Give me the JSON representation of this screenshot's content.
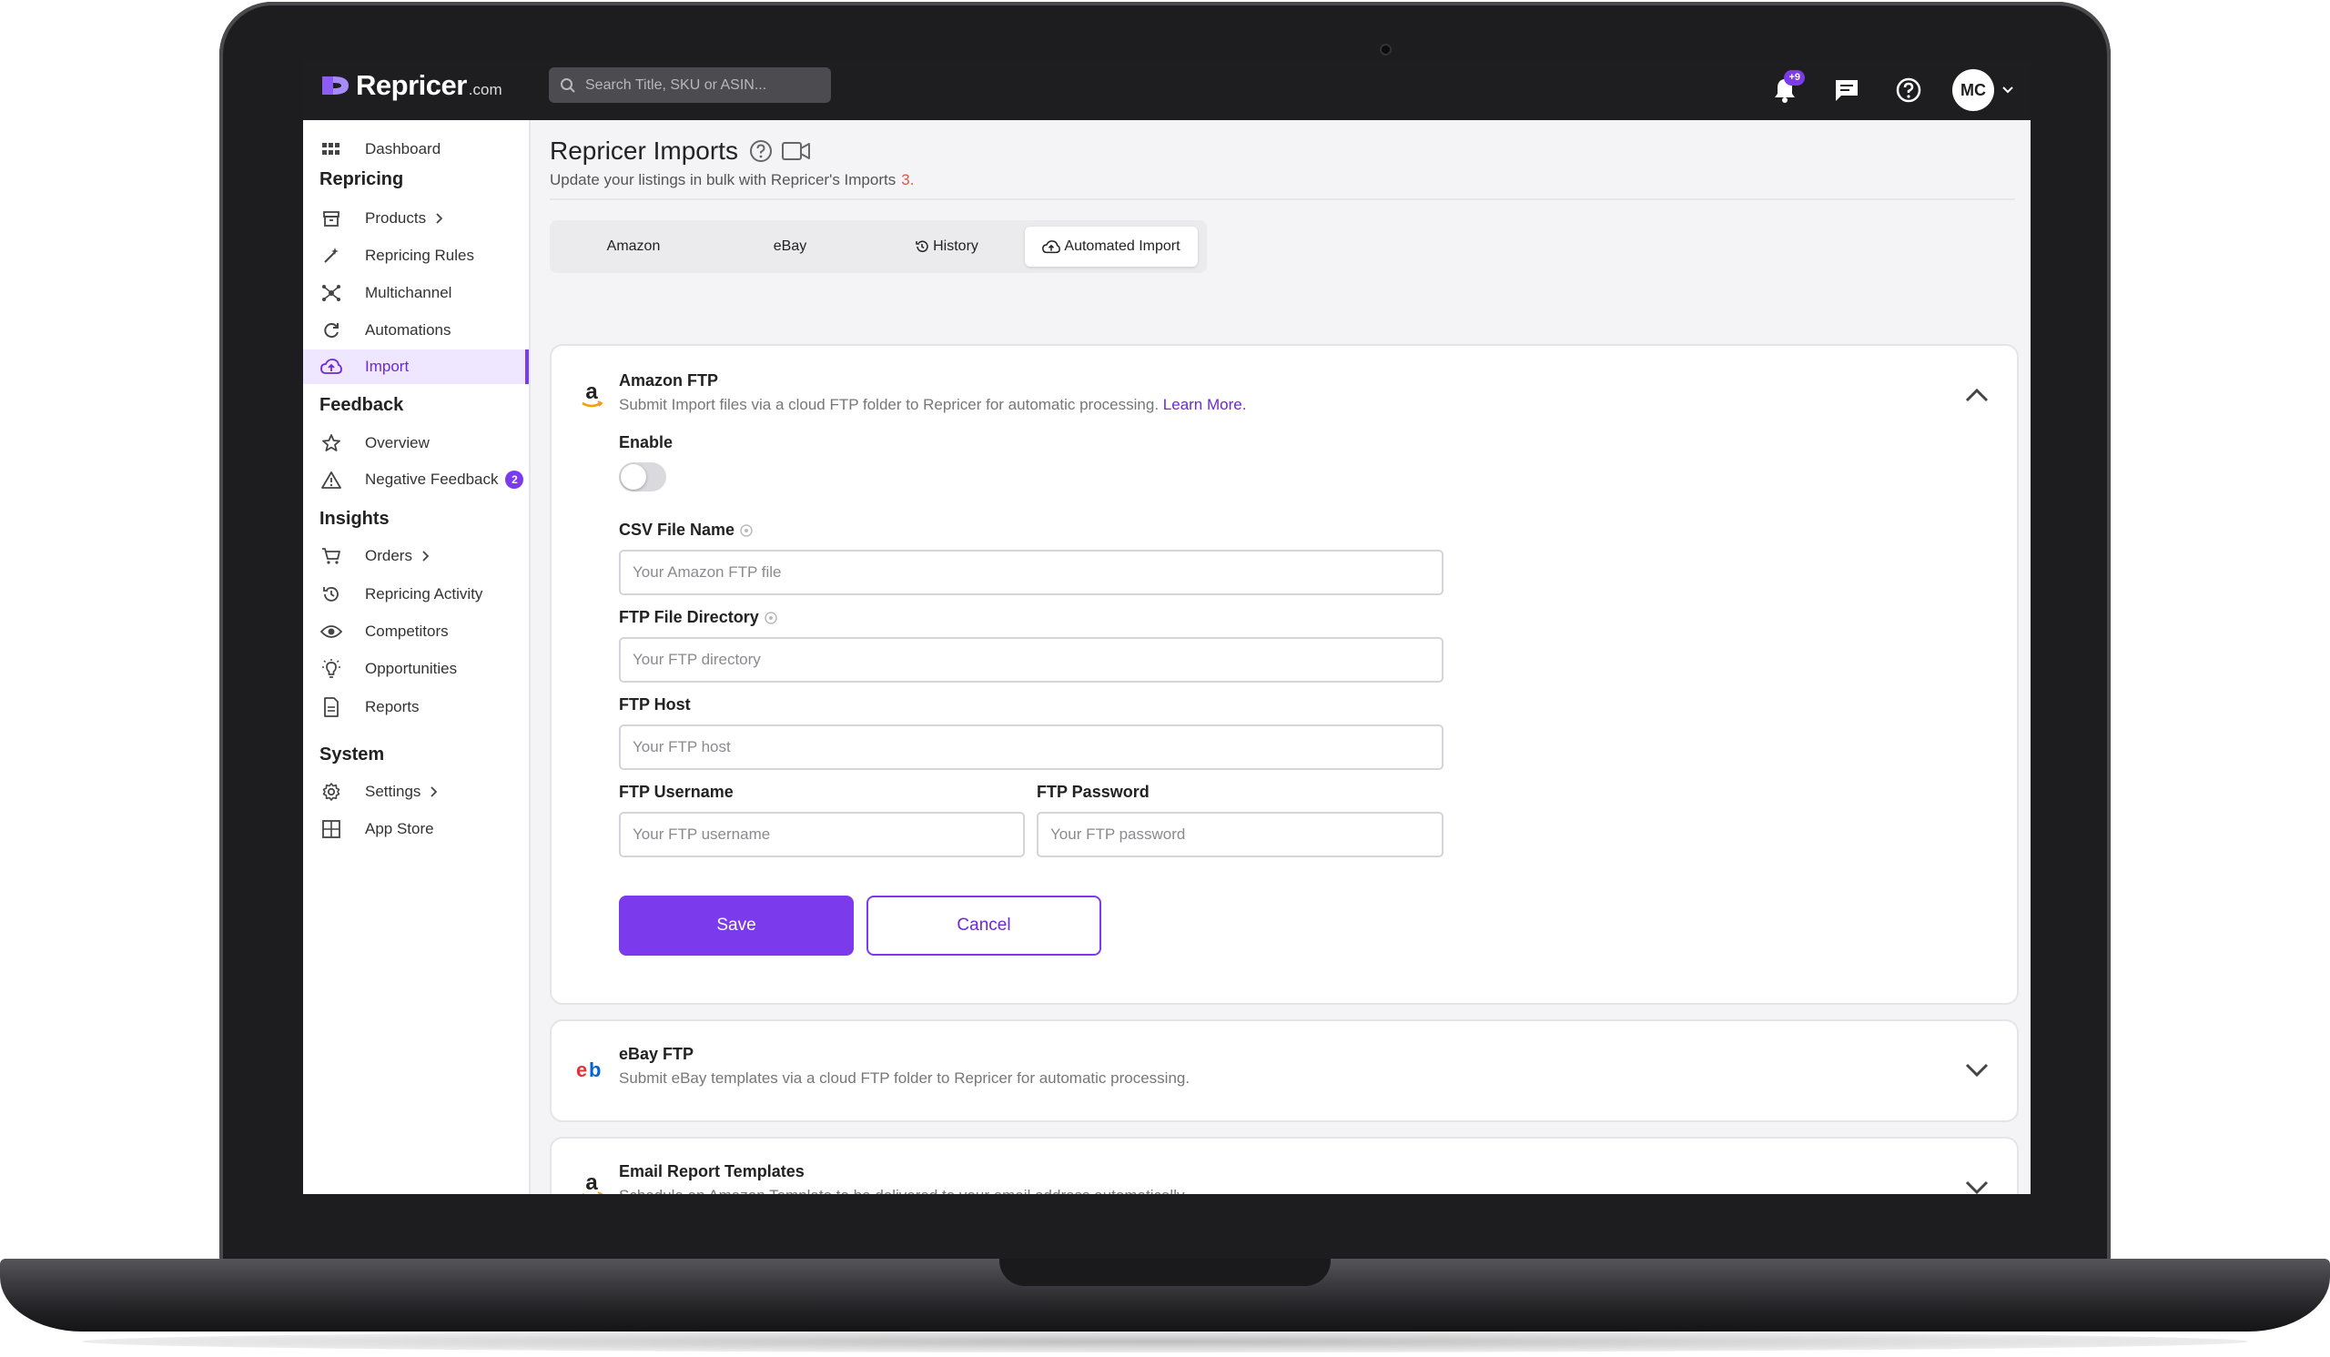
{
  "topbar": {
    "logo_text": "Repricer",
    "logo_suffix": ".com",
    "search_placeholder": "Search Title, SKU or ASIN...",
    "notification_count": "+9",
    "avatar_initials": "MC"
  },
  "sidebar": {
    "dashboard": "Dashboard",
    "sections": {
      "repricing": "Repricing",
      "feedback": "Feedback",
      "insights": "Insights",
      "system": "System"
    },
    "items": {
      "products": "Products",
      "repricing_rules": "Repricing Rules",
      "multichannel": "Multichannel",
      "automations": "Automations",
      "import": "Import",
      "overview": "Overview",
      "negative_feedback": "Negative Feedback",
      "negative_feedback_count": "2",
      "orders": "Orders",
      "repricing_activity": "Repricing Activity",
      "competitors": "Competitors",
      "opportunities": "Opportunities",
      "reports": "Reports",
      "settings": "Settings",
      "app_store": "App Store"
    }
  },
  "page": {
    "title": "Repricer Imports",
    "subtitle": "Update your listings in bulk with Repricer's Imports",
    "subtitle_link": "3."
  },
  "tabs": {
    "amazon": "Amazon",
    "ebay": "eBay",
    "history": "History",
    "automated_import": "Automated Import",
    "active": "automated_import"
  },
  "amazon_ftp": {
    "title": "Amazon FTP",
    "description": "Submit Import files via a cloud FTP folder to Repricer for automatic processing.",
    "learn_more": "Learn More.",
    "enable_label": "Enable",
    "enabled": false,
    "csv_label": "CSV File Name",
    "csv_placeholder": "Your Amazon FTP file",
    "dir_label": "FTP File Directory",
    "dir_placeholder": "Your FTP directory",
    "host_label": "FTP Host",
    "host_placeholder": "Your FTP host",
    "user_label": "FTP Username",
    "user_placeholder": "Your FTP username",
    "pass_label": "FTP Password",
    "pass_placeholder": "Your FTP password",
    "save": "Save",
    "cancel": "Cancel"
  },
  "ebay_ftp": {
    "title": "eBay FTP",
    "description": "Submit eBay templates via a cloud FTP folder to Repricer for automatic processing."
  },
  "email_templates": {
    "title": "Email Report Templates",
    "description": "Schedule an Amazon Template to be delivered to your email address automatically."
  },
  "colors": {
    "accent": "#7c3aed",
    "topbar": "#1e1e20",
    "active_bg": "#efe7ff"
  }
}
